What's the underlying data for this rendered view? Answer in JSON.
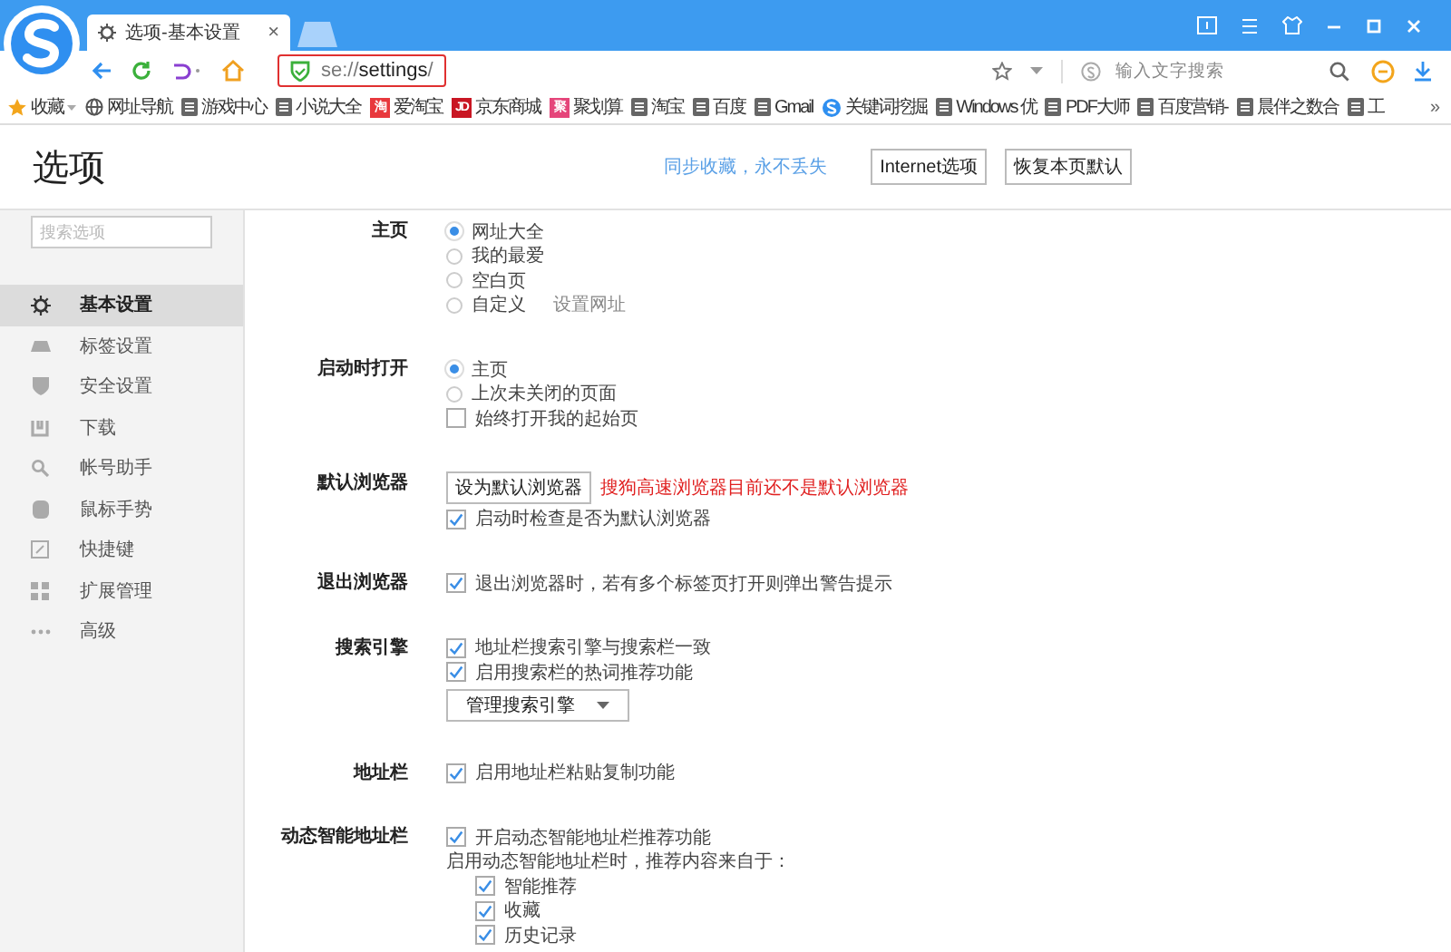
{
  "tab": {
    "title": "选项-基本设置",
    "close": "×"
  },
  "address": {
    "scheme": "se://",
    "path": "settings",
    "trail": "/",
    "highlighted": true
  },
  "search": {
    "placeholder": "输入文字搜索"
  },
  "bookmarks": [
    {
      "kind": "favorites",
      "label": "收藏"
    },
    {
      "kind": "globe",
      "label": "网址导航"
    },
    {
      "kind": "doc",
      "label": "游戏中心"
    },
    {
      "kind": "doc",
      "label": "小说大全"
    },
    {
      "kind": "logo",
      "label": "爱淘宝",
      "icon_text": "淘",
      "color": "#e8383d"
    },
    {
      "kind": "logo",
      "label": "京东商城",
      "icon_text": "JD",
      "color": "#c91623"
    },
    {
      "kind": "logo",
      "label": "聚划算",
      "icon_text": "聚",
      "color": "#e5457a"
    },
    {
      "kind": "doc",
      "label": "淘宝"
    },
    {
      "kind": "doc",
      "label": "百度"
    },
    {
      "kind": "doc",
      "label": "Gmail"
    },
    {
      "kind": "swirl",
      "label": "关键词挖掘"
    },
    {
      "kind": "doc",
      "label": "Windows 优"
    },
    {
      "kind": "doc",
      "label": "PDF大师"
    },
    {
      "kind": "doc",
      "label": "百度营销-"
    },
    {
      "kind": "doc",
      "label": "晨伴之数合"
    },
    {
      "kind": "doc",
      "label": "工"
    }
  ],
  "bookmarks_more": "»",
  "page": {
    "title": "选项",
    "sync_link": "同步收藏，永不丢失",
    "buttons": [
      "Internet选项",
      "恢复本页默认"
    ]
  },
  "sidebar": {
    "search_placeholder": "搜索选项",
    "items": [
      {
        "label": "基本设置",
        "selected": true
      },
      {
        "label": "标签设置",
        "selected": false
      },
      {
        "label": "安全设置",
        "selected": false
      },
      {
        "label": "下载",
        "selected": false
      },
      {
        "label": "帐号助手",
        "selected": false
      },
      {
        "label": "鼠标手势",
        "selected": false
      },
      {
        "label": "快捷键",
        "selected": false
      },
      {
        "label": "扩展管理",
        "selected": false
      },
      {
        "label": "高级",
        "selected": false
      }
    ]
  },
  "sections": [
    {
      "label": "主页",
      "items": [
        {
          "kind": "radio",
          "label": "网址大全",
          "selected": true
        },
        {
          "kind": "radio",
          "label": "我的最爱",
          "selected": false
        },
        {
          "kind": "radio",
          "label": "空白页",
          "selected": false
        },
        {
          "kind": "radio",
          "label": "自定义",
          "selected": false,
          "link": "设置网址"
        }
      ]
    },
    {
      "label": "启动时打开",
      "items": [
        {
          "kind": "radio",
          "label": "主页",
          "selected": true
        },
        {
          "kind": "radio",
          "label": "上次未关闭的页面",
          "selected": false
        },
        {
          "kind": "checkbox",
          "label": "始终打开我的起始页",
          "checked": false
        }
      ]
    },
    {
      "label": "默认浏览器",
      "items": [
        {
          "kind": "button",
          "label": "设为默认浏览器",
          "warning": "搜狗高速浏览器目前还不是默认浏览器"
        },
        {
          "kind": "checkbox",
          "label": "启动时检查是否为默认浏览器",
          "checked": true
        }
      ]
    },
    {
      "label": "退出浏览器",
      "items": [
        {
          "kind": "checkbox",
          "label": "退出浏览器时，若有多个标签页打开则弹出警告提示",
          "checked": true
        }
      ]
    },
    {
      "label": "搜索引擎",
      "items": [
        {
          "kind": "checkbox",
          "label": "地址栏搜索引擎与搜索栏一致",
          "checked": true
        },
        {
          "kind": "checkbox",
          "label": "启用搜索栏的热词推荐功能",
          "checked": true
        },
        {
          "kind": "dropdown",
          "label": "管理搜索引擎"
        }
      ]
    },
    {
      "label": "地址栏",
      "items": [
        {
          "kind": "checkbox",
          "label": "启用地址栏粘贴复制功能",
          "checked": true
        }
      ]
    },
    {
      "label": "动态智能地址栏",
      "items": [
        {
          "kind": "checkbox",
          "label": "开启动态智能地址栏推荐功能",
          "checked": true
        },
        {
          "kind": "note",
          "label": "启用动态智能地址栏时，推荐内容来自于：",
          "children": [
            {
              "kind": "checkbox",
              "label": "智能推荐",
              "checked": true
            },
            {
              "kind": "checkbox",
              "label": "收藏",
              "checked": true
            },
            {
              "kind": "checkbox",
              "label": "历史记录",
              "checked": true
            }
          ]
        }
      ]
    }
  ]
}
